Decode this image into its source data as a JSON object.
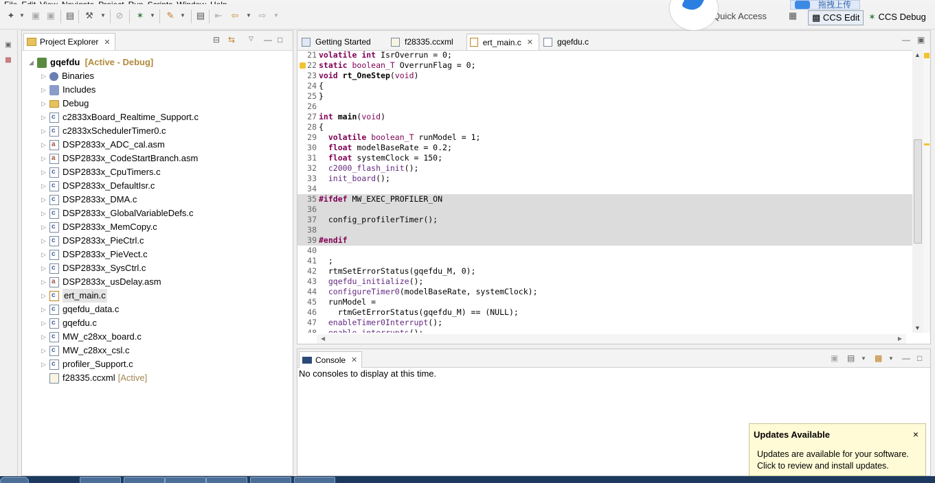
{
  "menubar": {
    "items": [
      "File",
      "Edit",
      "View",
      "Navigate",
      "Project",
      "Run",
      "Scripts",
      "Window",
      "Help"
    ]
  },
  "toolbar": {
    "quick_access": "Quick Access",
    "perspectives": [
      {
        "label": "CCS Edit",
        "active": true
      },
      {
        "label": "CCS Debug",
        "active": false
      }
    ],
    "upload_overlay": "拖拽上传"
  },
  "project_explorer": {
    "title": "Project Explorer",
    "project": {
      "name": "gqefdu",
      "status": "[Active - Debug]"
    },
    "items": [
      {
        "label": "Binaries",
        "icon": "binaries-icon"
      },
      {
        "label": "Includes",
        "icon": "includes-icon"
      },
      {
        "label": "Debug",
        "icon": "folder-icon"
      },
      {
        "label": "c2833xBoard_Realtime_Support.c",
        "icon": "c-file-icon"
      },
      {
        "label": "c2833xSchedulerTimer0.c",
        "icon": "c-file-icon"
      },
      {
        "label": "DSP2833x_ADC_cal.asm",
        "icon": "asm-file-icon"
      },
      {
        "label": "DSP2833x_CodeStartBranch.asm",
        "icon": "asm-file-icon"
      },
      {
        "label": "DSP2833x_CpuTimers.c",
        "icon": "c-file-icon"
      },
      {
        "label": "DSP2833x_DefaultIsr.c",
        "icon": "c-file-icon"
      },
      {
        "label": "DSP2833x_DMA.c",
        "icon": "c-file-icon"
      },
      {
        "label": "DSP2833x_GlobalVariableDefs.c",
        "icon": "c-file-icon"
      },
      {
        "label": "DSP2833x_MemCopy.c",
        "icon": "c-file-icon"
      },
      {
        "label": "DSP2833x_PieCtrl.c",
        "icon": "c-file-icon"
      },
      {
        "label": "DSP2833x_PieVect.c",
        "icon": "c-file-icon"
      },
      {
        "label": "DSP2833x_SysCtrl.c",
        "icon": "c-file-icon"
      },
      {
        "label": "DSP2833x_usDelay.asm",
        "icon": "asm-file-icon"
      },
      {
        "label": "ert_main.c",
        "icon": "c-file-warning-icon",
        "selected": true
      },
      {
        "label": "gqefdu_data.c",
        "icon": "c-file-icon"
      },
      {
        "label": "gqefdu.c",
        "icon": "c-file-icon"
      },
      {
        "label": "MW_c28xx_board.c",
        "icon": "c-file-icon"
      },
      {
        "label": "MW_c28xx_csl.c",
        "icon": "c-file-icon"
      },
      {
        "label": "profiler_Support.c",
        "icon": "c-file-icon"
      },
      {
        "label": "f28335.ccxml",
        "icon": "ccxml-file-icon",
        "tag": "[Active]"
      }
    ]
  },
  "editor": {
    "tabs": [
      {
        "label": "Getting Started",
        "active": false
      },
      {
        "label": "f28335.ccxml",
        "active": false
      },
      {
        "label": "ert_main.c",
        "active": true
      },
      {
        "label": "gqefdu.c",
        "active": false
      }
    ],
    "lines": [
      {
        "n": "21",
        "segs": [
          [
            "kw",
            "volatile"
          ],
          [
            "t",
            " "
          ],
          [
            "kw",
            "int"
          ],
          [
            "t",
            " IsrOverrun = 0;"
          ]
        ]
      },
      {
        "n": "22",
        "warn": true,
        "segs": [
          [
            "kw",
            "static"
          ],
          [
            "t",
            " "
          ],
          [
            "ty",
            "boolean_T"
          ],
          [
            "t",
            " OverrunFlag = 0;"
          ]
        ]
      },
      {
        "n": "23",
        "segs": [
          [
            "kw",
            "void"
          ],
          [
            "t",
            " "
          ],
          [
            "fnb",
            "rt_OneStep"
          ],
          [
            "t",
            "("
          ],
          [
            "ty",
            "void"
          ],
          [
            "t",
            ")"
          ]
        ]
      },
      {
        "n": "24",
        "segs": [
          [
            "t",
            "{"
          ]
        ]
      },
      {
        "n": "25",
        "segs": [
          [
            "t",
            "}"
          ]
        ]
      },
      {
        "n": "26",
        "segs": [
          [
            "t",
            ""
          ]
        ]
      },
      {
        "n": "27",
        "segs": [
          [
            "kw",
            "int"
          ],
          [
            "t",
            " "
          ],
          [
            "fnb",
            "main"
          ],
          [
            "t",
            "("
          ],
          [
            "ty",
            "void"
          ],
          [
            "t",
            ")"
          ]
        ]
      },
      {
        "n": "28",
        "segs": [
          [
            "t",
            "{"
          ]
        ]
      },
      {
        "n": "29",
        "segs": [
          [
            "t",
            "  "
          ],
          [
            "kw",
            "volatile"
          ],
          [
            "t",
            " "
          ],
          [
            "ty",
            "boolean_T"
          ],
          [
            "t",
            " runModel = 1;"
          ]
        ]
      },
      {
        "n": "30",
        "segs": [
          [
            "t",
            "  "
          ],
          [
            "kw",
            "float"
          ],
          [
            "t",
            " modelBaseRate = 0.2;"
          ]
        ]
      },
      {
        "n": "31",
        "segs": [
          [
            "t",
            "  "
          ],
          [
            "kw",
            "float"
          ],
          [
            "t",
            " systemClock = 150;"
          ]
        ]
      },
      {
        "n": "32",
        "segs": [
          [
            "t",
            "  "
          ],
          [
            "fn",
            "c2000_flash_init"
          ],
          [
            "t",
            "();"
          ]
        ]
      },
      {
        "n": "33",
        "segs": [
          [
            "t",
            "  "
          ],
          [
            "fn",
            "init_board"
          ],
          [
            "t",
            "();"
          ]
        ]
      },
      {
        "n": "34",
        "segs": [
          [
            "t",
            ""
          ]
        ]
      },
      {
        "n": "35",
        "shade": true,
        "segs": [
          [
            "kw",
            "#ifdef"
          ],
          [
            "t",
            " MW_EXEC_PROFILER_ON"
          ]
        ]
      },
      {
        "n": "36",
        "shade": true,
        "segs": [
          [
            "t",
            ""
          ]
        ]
      },
      {
        "n": "37",
        "shade": true,
        "segs": [
          [
            "t",
            "  config_profilerTimer();"
          ]
        ]
      },
      {
        "n": "38",
        "shade": true,
        "segs": [
          [
            "t",
            ""
          ]
        ]
      },
      {
        "n": "39",
        "shade": true,
        "segs": [
          [
            "kw",
            "#endif"
          ]
        ]
      },
      {
        "n": "40",
        "segs": [
          [
            "t",
            ""
          ]
        ]
      },
      {
        "n": "41",
        "segs": [
          [
            "t",
            "  ;"
          ]
        ]
      },
      {
        "n": "42",
        "segs": [
          [
            "t",
            "  rtmSetErrorStatus(gqefdu_M, 0);"
          ]
        ]
      },
      {
        "n": "43",
        "segs": [
          [
            "t",
            "  "
          ],
          [
            "fn",
            "gqefdu_initialize"
          ],
          [
            "t",
            "();"
          ]
        ]
      },
      {
        "n": "44",
        "segs": [
          [
            "t",
            "  "
          ],
          [
            "fn",
            "configureTimer0"
          ],
          [
            "t",
            "(modelBaseRate, systemClock);"
          ]
        ]
      },
      {
        "n": "45",
        "segs": [
          [
            "t",
            "  runModel ="
          ]
        ]
      },
      {
        "n": "46",
        "segs": [
          [
            "t",
            "    rtmGetErrorStatus(gqefdu_M) == (NULL);"
          ]
        ]
      },
      {
        "n": "47",
        "segs": [
          [
            "t",
            "  "
          ],
          [
            "fn",
            "enableTimer0Interrupt"
          ],
          [
            "t",
            "();"
          ]
        ]
      },
      {
        "n": "48",
        "segs": [
          [
            "t",
            "  "
          ],
          [
            "fn",
            "enable_interrupts"
          ],
          [
            "t",
            "();"
          ]
        ]
      }
    ]
  },
  "console": {
    "title": "Console",
    "message": "No consoles to display at this time."
  },
  "updates": {
    "title": "Updates Available",
    "line1": "Updates are available for your software.",
    "line2": "Click to review and install updates.",
    "close": "×"
  }
}
